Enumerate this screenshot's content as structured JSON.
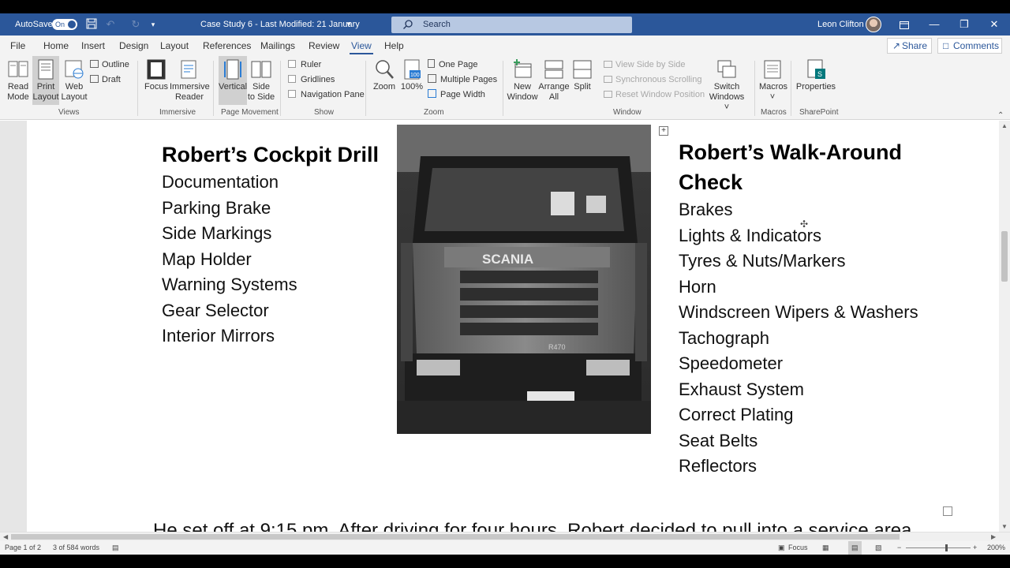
{
  "titlebar": {
    "autosave_label": "AutoSave",
    "autosave_state": "On",
    "doc_title": "Case Study 6  -  Last Modified: 21 January",
    "search_placeholder": "Search",
    "user_name": "Leon Clifton"
  },
  "menu": {
    "tabs": [
      "File",
      "Home",
      "Insert",
      "Design",
      "Layout",
      "References",
      "Mailings",
      "Review",
      "View",
      "Help"
    ],
    "active_tab": "View",
    "share_label": "Share",
    "comments_label": "Comments"
  },
  "ribbon": {
    "views": {
      "read_mode": [
        "Read",
        "Mode"
      ],
      "print_layout": [
        "Print",
        "Layout"
      ],
      "web_layout": [
        "Web",
        "Layout"
      ],
      "outline": "Outline",
      "draft": "Draft",
      "group_label": "Views"
    },
    "immersive": {
      "focus": "Focus",
      "immersive_reader": [
        "Immersive",
        "Reader"
      ],
      "group_label": "Immersive"
    },
    "page_movement": {
      "vertical": "Vertical",
      "side_to_side": [
        "Side",
        "to Side"
      ],
      "group_label": "Page Movement"
    },
    "show": {
      "ruler": "Ruler",
      "gridlines": "Gridlines",
      "navigation_pane": "Navigation Pane",
      "group_label": "Show"
    },
    "zoom": {
      "zoom": "Zoom",
      "hundred": "100%",
      "one_page": "One Page",
      "multiple_pages": "Multiple Pages",
      "page_width": "Page Width",
      "group_label": "Zoom"
    },
    "window": {
      "new_window": [
        "New",
        "Window"
      ],
      "arrange_all": [
        "Arrange",
        "All"
      ],
      "split": "Split",
      "view_side_by_side": "View Side by Side",
      "synchronous_scrolling": "Synchronous Scrolling",
      "reset_window_position": "Reset Window Position",
      "switch_windows": [
        "Switch",
        "Windows ˅"
      ],
      "group_label": "Window"
    },
    "macros": {
      "macros": "Macros",
      "group_label": "Macros"
    },
    "sharepoint": {
      "properties": "Properties",
      "group_label": "SharePoint"
    }
  },
  "document": {
    "left_heading": "Robert’s Cockpit Drill",
    "left_items": [
      "Documentation",
      "Parking Brake",
      "Side Markings",
      "Map Holder",
      "Warning Systems",
      "Gear Selector",
      "Interior Mirrors"
    ],
    "right_heading": "Robert’s Walk-Around Check",
    "right_items": [
      "Brakes",
      "Lights & Indicators",
      "Tyres & Nuts/Markers",
      "Horn",
      "Windscreen Wipers & Washers",
      "Tachograph",
      "Speedometer",
      "Exhaust System",
      "Correct Plating",
      "Seat Belts",
      "Reflectors"
    ],
    "photo_brand": "SCANIA",
    "photo_model": "R470",
    "cut_line": "He set off at 9:15 pm. After driving for four hours, Robert decided to pull into a service area"
  },
  "statusbar": {
    "page": "Page 1 of 2",
    "words": "3 of 584 words",
    "focus": "Focus",
    "zoom": "200%"
  },
  "colors": {
    "accent": "#2b579a",
    "ribbon_bg": "#f3f3f3",
    "doc_bg": "#e6e6e6"
  }
}
